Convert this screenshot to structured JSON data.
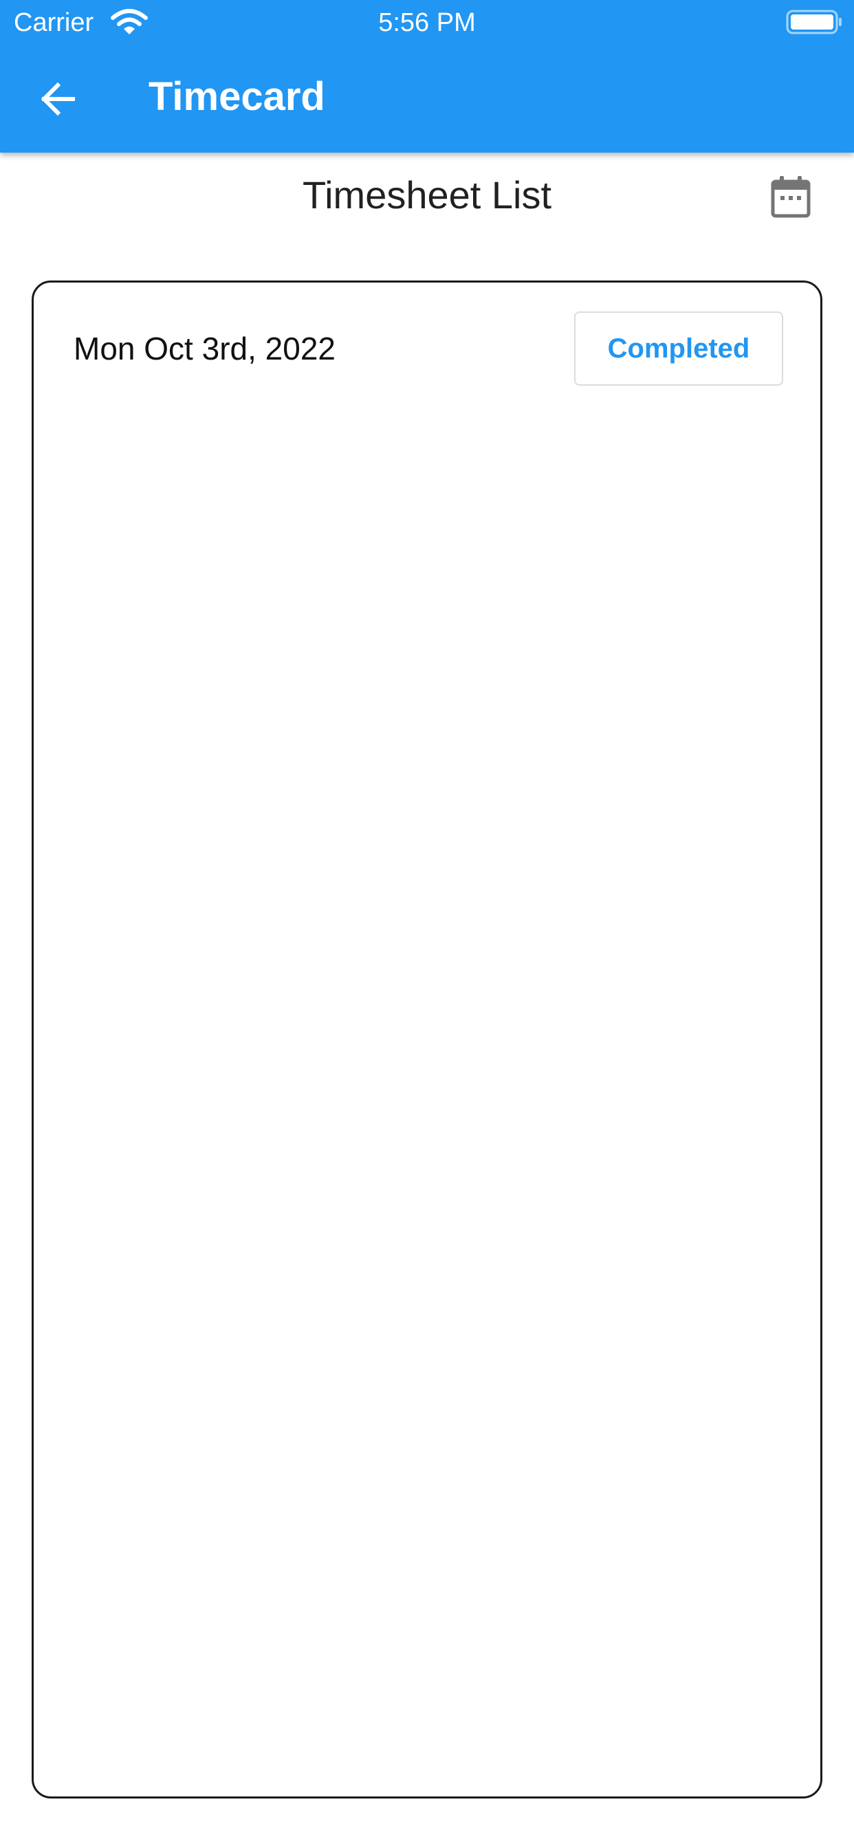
{
  "status_bar": {
    "carrier": "Carrier",
    "time": "5:56 PM",
    "wifi_icon": "wifi-icon",
    "battery_icon": "battery-icon"
  },
  "app_bar": {
    "title": "Timecard",
    "back_icon": "arrow-back-icon",
    "color": "#2196F3"
  },
  "header": {
    "title": "Timesheet List",
    "calendar_icon": "calendar-icon"
  },
  "timesheets": [
    {
      "date": "Mon Oct 3rd, 2022",
      "status": "Completed"
    }
  ],
  "colors": {
    "accent": "#2196F3",
    "card_border": "#1a1a1a",
    "icon_gray": "#757575"
  }
}
